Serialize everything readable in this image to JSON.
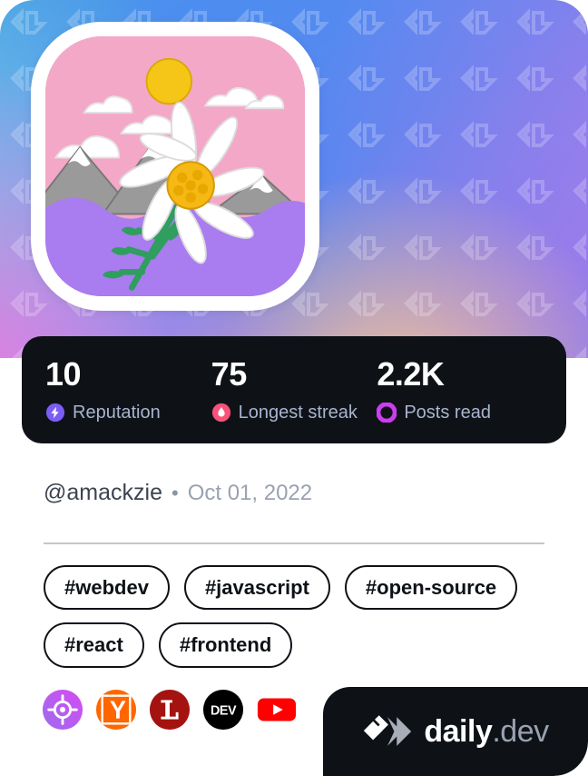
{
  "card": {
    "type": "devcard",
    "brand": {
      "name_primary": "daily",
      "name_secondary": ".dev",
      "mark_icon": "daily-dev-chevron-logo",
      "background": "#0e1217"
    }
  },
  "cover": {
    "pattern_icon": "daily-dev-watermark-pattern",
    "gradient_colors": [
      "#3aa8d8",
      "#4d8df0",
      "#8f7ae8",
      "#ec7ae0",
      "#ffcd8c",
      "#82dee2"
    ]
  },
  "avatar": {
    "alt": "edelweiss flower illustration with mountains",
    "icon": "avatar-image",
    "colors": {
      "sky": "#f4a8c8",
      "sun": "#f5c518",
      "cloud": "#ffffff",
      "mountain": "#9a9a9a",
      "ground": "#a97cf0",
      "petal": "#ffffff",
      "center": "#f5b814",
      "stem": "#2f9e5e"
    }
  },
  "stats": {
    "background": "#0e1217",
    "items": [
      {
        "value": "10",
        "label": "Reputation",
        "icon": "reputation-bolt-icon",
        "color": "#7b5cf5"
      },
      {
        "value": "75",
        "label": "Longest streak",
        "icon": "streak-flame-icon",
        "color": "#f8527a"
      },
      {
        "value": "2.2K",
        "label": "Posts read",
        "icon": "posts-read-ring-icon",
        "color": "#cd3df0"
      }
    ]
  },
  "profile": {
    "handle": "@amackzie",
    "separator": "•",
    "date": "Oct 01, 2022"
  },
  "tags": [
    {
      "label": "#webdev"
    },
    {
      "label": "#javascript"
    },
    {
      "label": "#open-source"
    },
    {
      "label": "#react"
    },
    {
      "label": "#frontend"
    }
  ],
  "socials": [
    {
      "name": "roadmap-sh",
      "icon": "roadmap-target-icon",
      "color": "#b35cf0"
    },
    {
      "name": "hacker-news",
      "icon": "hacker-news-y-icon",
      "color": "#ff6600"
    },
    {
      "name": "lintree",
      "icon": "lintree-l-icon",
      "color": "#a41310"
    },
    {
      "name": "dev-to",
      "icon": "dev-to-icon",
      "color": "#000000"
    },
    {
      "name": "youtube",
      "icon": "youtube-play-icon",
      "color": "#ff0000"
    }
  ]
}
